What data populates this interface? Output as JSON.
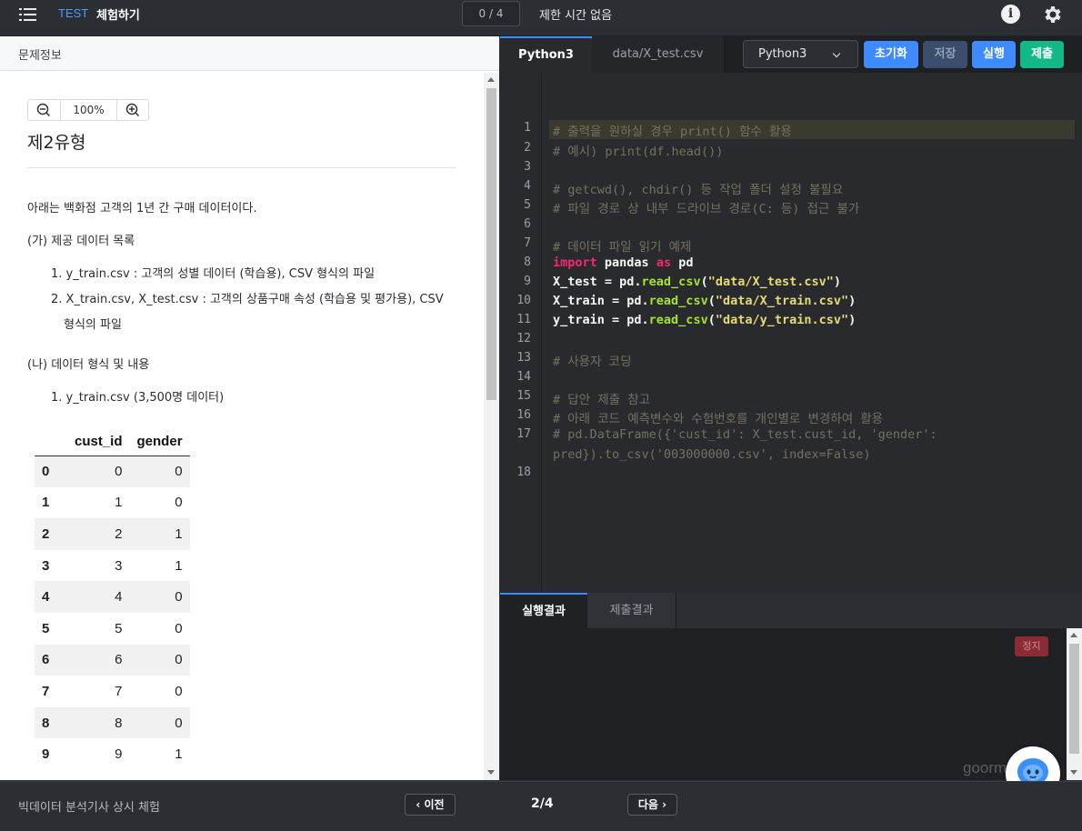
{
  "topbar": {
    "logo": "TEST",
    "title": "체험하기",
    "counter": "0 / 4",
    "time_limit": "제한 시간 없음"
  },
  "left": {
    "header": "문제정보",
    "zoom_value": "100%",
    "problem_title": "제2유형",
    "intro": "아래는 백화점 고객의 1년 간 구매 데이터이다.",
    "section_a": "(가) 제공 데이터 목록",
    "list_a": [
      "1. y_train.csv : 고객의 성별 데이터 (학습용), CSV 형식의 파일",
      "2. X_train.csv, X_test.csv : 고객의 상품구매 속성 (학습용 및 평가용), CSV",
      "형식의 파일"
    ],
    "section_b": "(나) 데이터 형식 및 내용",
    "list_b": [
      "1. y_train.csv (3,500명 데이터)"
    ],
    "table": {
      "headers": [
        "cust_id",
        "gender"
      ],
      "rows": [
        [
          "0",
          "0",
          "0"
        ],
        [
          "1",
          "1",
          "0"
        ],
        [
          "2",
          "2",
          "1"
        ],
        [
          "3",
          "3",
          "1"
        ],
        [
          "4",
          "4",
          "0"
        ],
        [
          "5",
          "5",
          "0"
        ],
        [
          "6",
          "6",
          "0"
        ],
        [
          "7",
          "7",
          "0"
        ],
        [
          "8",
          "8",
          "0"
        ],
        [
          "9",
          "9",
          "1"
        ]
      ]
    }
  },
  "editor": {
    "tabs": [
      "Python3",
      "data/X_test.csv"
    ],
    "language": "Python3",
    "buttons": {
      "reset": "초기화",
      "save": "저장",
      "run": "실행",
      "submit": "제출"
    },
    "colors": {
      "reset": "#3d8bff",
      "save": "#3a4e6b",
      "run": "#3d8bff",
      "submit": "#12b886"
    },
    "line_numbers": [
      "1",
      "2",
      "3",
      "4",
      "5",
      "6",
      "7",
      "8",
      "9",
      "10",
      "11",
      "12",
      "13",
      "14",
      "15",
      "16",
      "17",
      "18"
    ],
    "lines": {
      "l1": "# 출력을 원하실 경우 print() 함수 활용",
      "l2": "# 예시) print(df.head())",
      "l4": "# getcwd(), chdir() 등 작업 폴더 설정 불필요",
      "l5": "# 파일 경로 상 내부 드라이브 경로(C: 등) 접근 불가",
      "l7": "# 데이터 파일 읽기 예제",
      "l8_kw1": "import",
      "l8_mid": " pandas ",
      "l8_kw2": "as",
      "l8_end": " pd",
      "l9_a": "X_test = pd.",
      "l9_fn": "read_csv",
      "l9_p1": "(",
      "l9_str": "\"data/X_test.csv\"",
      "l9_p2": ")",
      "l10_a": "X_train = pd.",
      "l10_fn": "read_csv",
      "l10_p1": "(",
      "l10_str": "\"data/X_train.csv\"",
      "l10_p2": ")",
      "l11_a": "y_train = pd.",
      "l11_fn": "read_csv",
      "l11_p1": "(",
      "l11_str": "\"data/y_train.csv\"",
      "l11_p2": ")",
      "l13": "# 사용자 코딩",
      "l15": "# 답안 제출 참고",
      "l16": "# 아래 코드 예측변수와 수험번호를 개인별로 변경하여 활용",
      "l17a": "# pd.DataFrame({'cust_id': X_test.cust_id, 'gender':",
      "l17b": "pred}).to_csv('003000000.csv', index=False)"
    }
  },
  "output": {
    "tabs": [
      "실행결과",
      "제출결과"
    ],
    "stop": "정지",
    "watermark": "goorm"
  },
  "footer": {
    "text": "빅데이터 분석기사 상시 체험",
    "prev": "이전",
    "page": "2/4",
    "next": "다음"
  }
}
